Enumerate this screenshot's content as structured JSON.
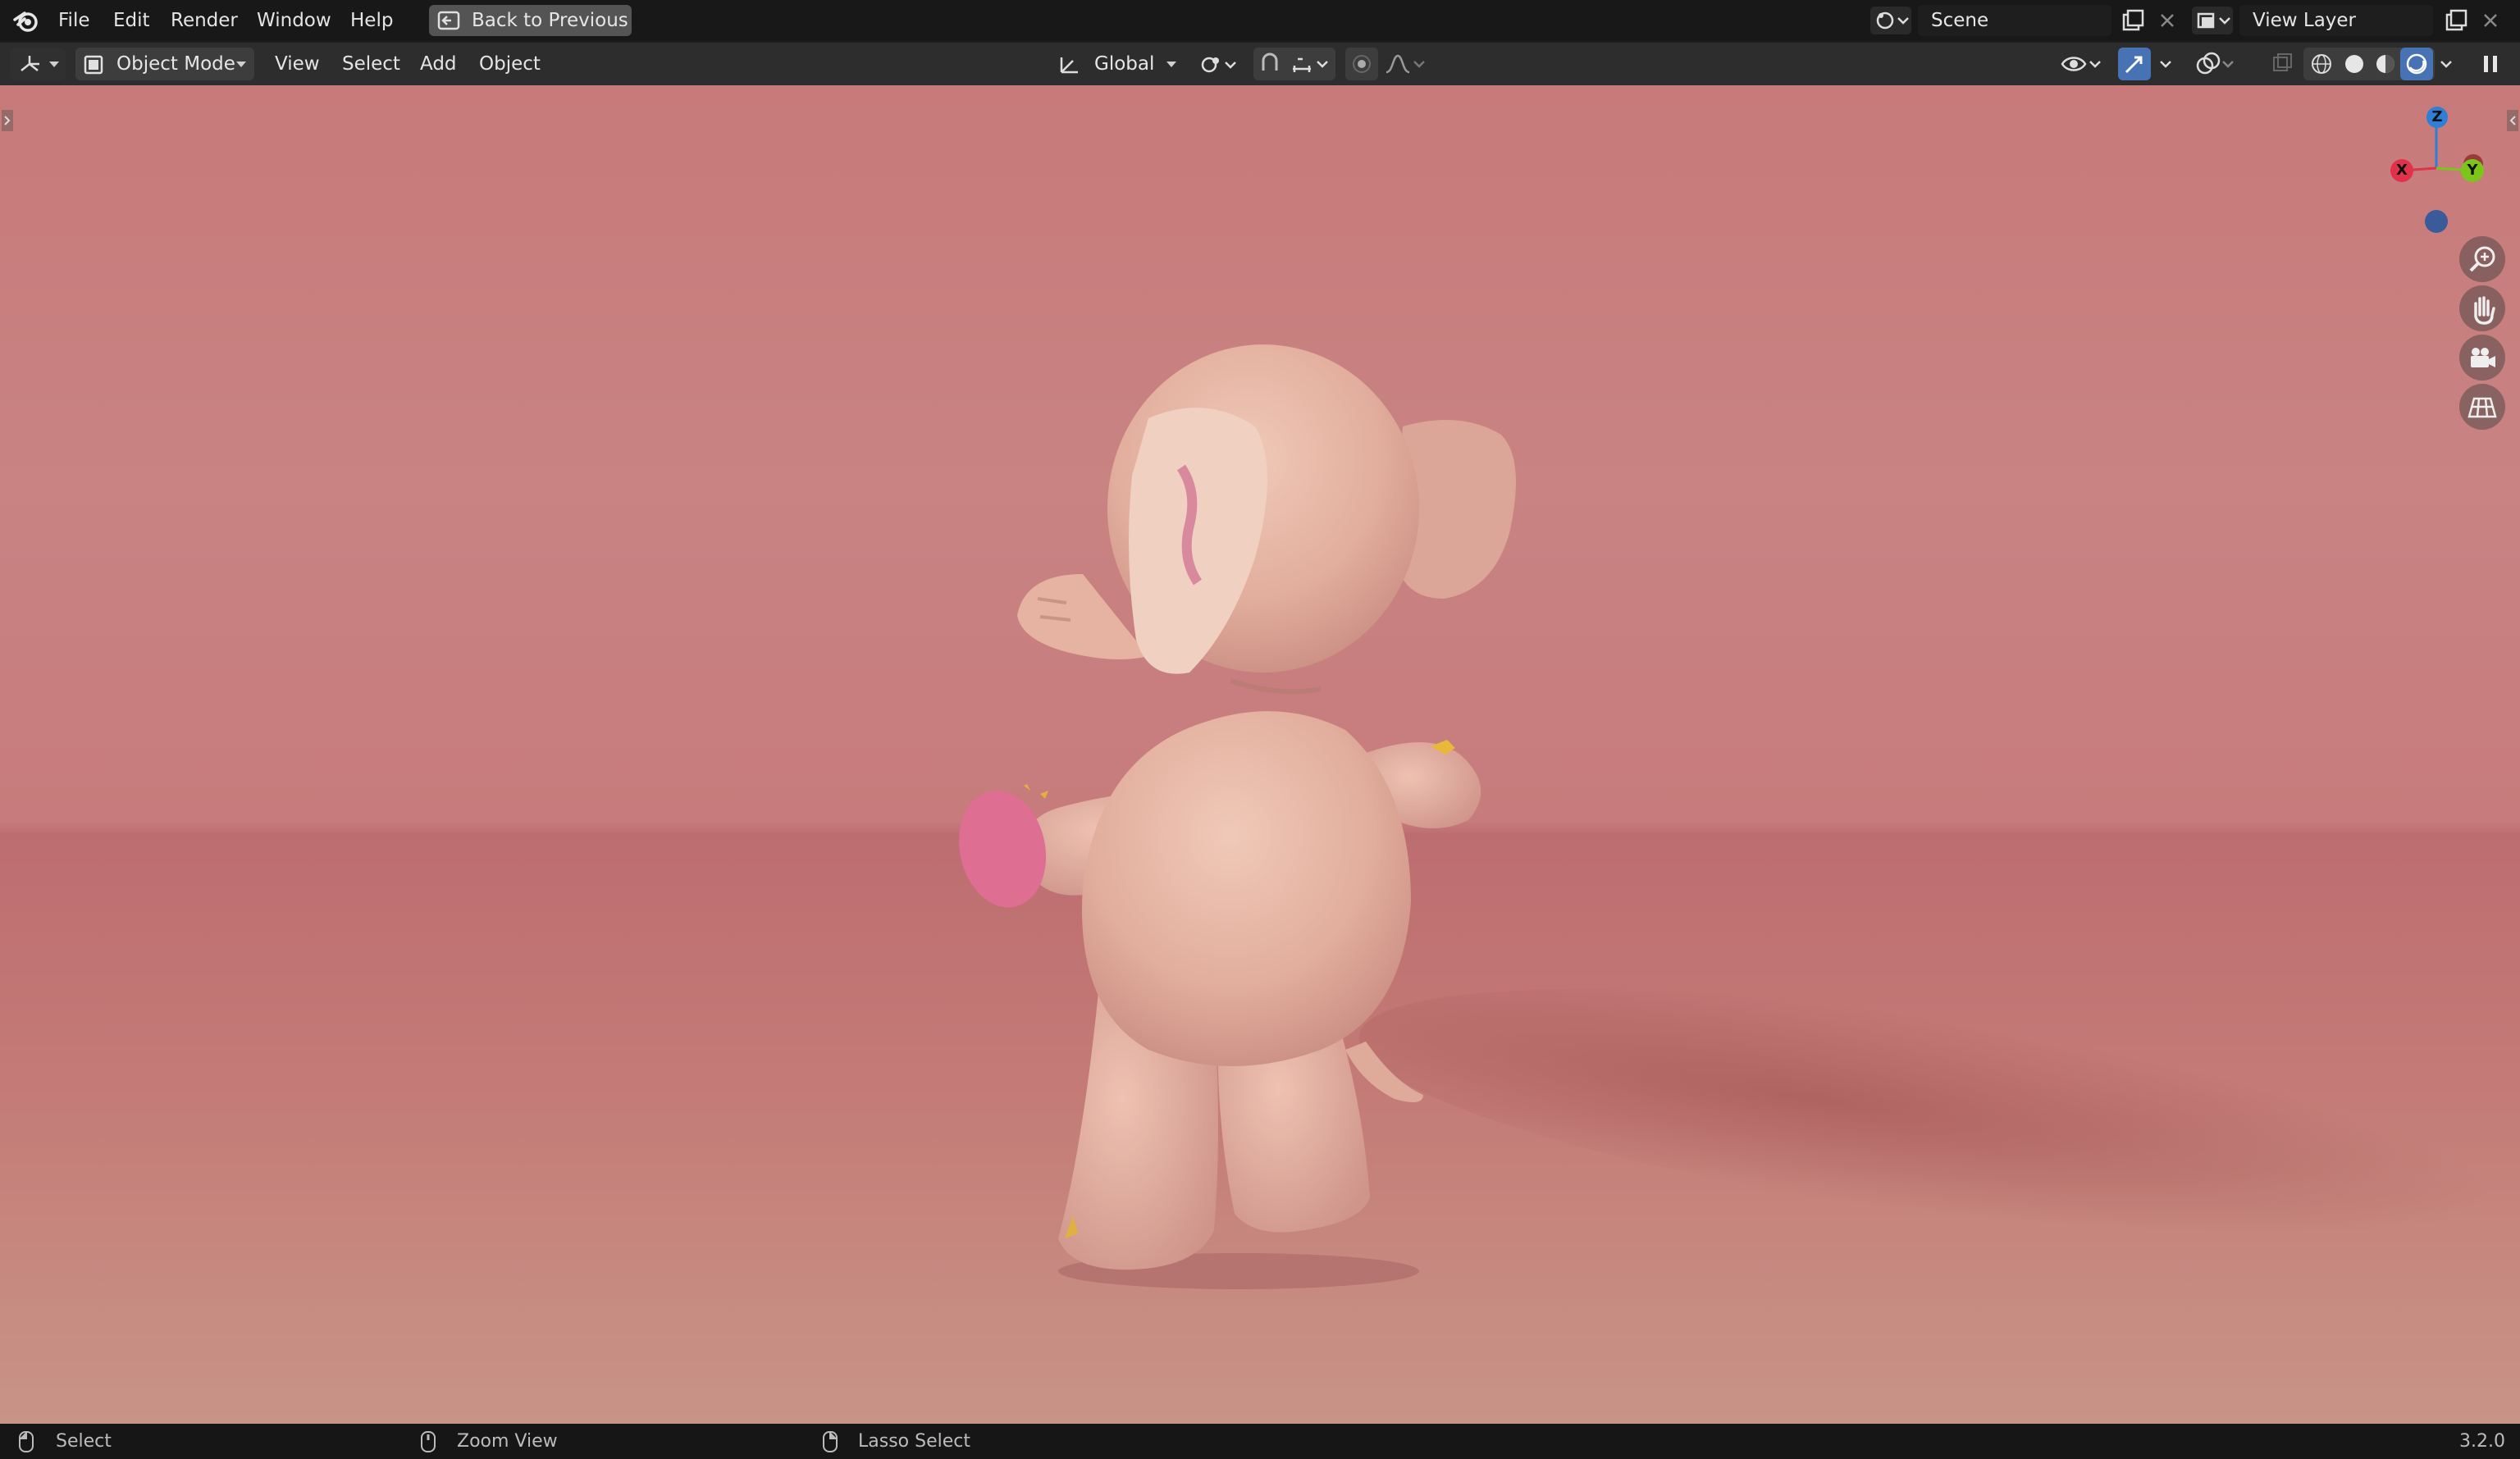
{
  "topbar": {
    "menus": [
      "File",
      "Edit",
      "Render",
      "Window",
      "Help"
    ],
    "back_button": "Back to Previous",
    "scene_name": "Scene",
    "view_layer": "View Layer"
  },
  "header": {
    "mode": "Object Mode",
    "menus": [
      "View",
      "Select",
      "Add",
      "Object"
    ],
    "transform_orientation": "Global"
  },
  "gizmo": {
    "z": "Z",
    "x": "X",
    "y": "Y"
  },
  "statusbar": {
    "select": "Select",
    "zoom": "Zoom View",
    "lasso": "Lasso Select",
    "version": "3.2.0"
  },
  "colors": {
    "accent": "#4772b3",
    "axis_x": "#e0334b",
    "axis_y": "#7cc51b",
    "axis_z": "#2f7fd6"
  }
}
